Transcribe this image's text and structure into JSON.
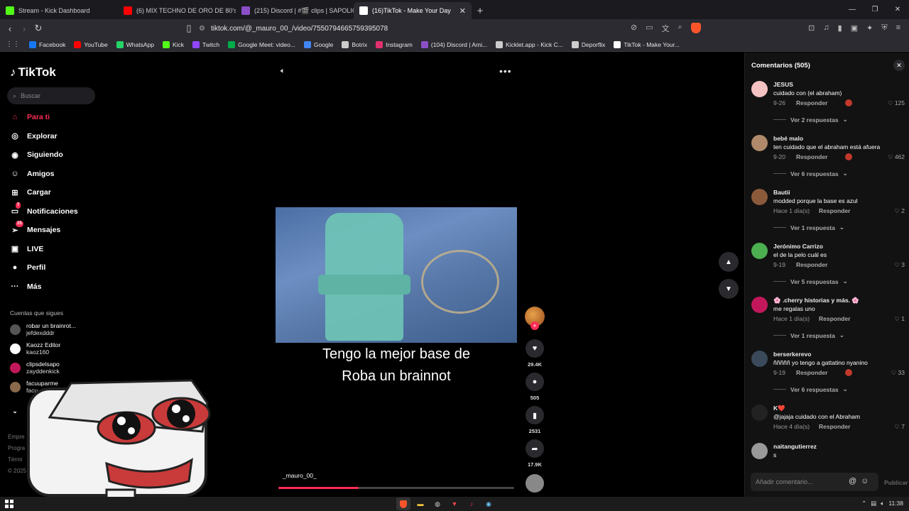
{
  "browser": {
    "tabs": [
      {
        "label": "Stream - Kick Dashboard",
        "color": "#53fc18",
        "active": false
      },
      {
        "label": "(6) MIX TECHNO DE ORO DE 80's &",
        "color": "#ff0000",
        "active": false
      },
      {
        "label": "(215) Discord | #🎬 clips | SAPOLIC",
        "color": "#8a4fc7",
        "active": false
      },
      {
        "label": "(16)TikTok - Make Your Day",
        "color": "#ffffff",
        "active": true
      }
    ],
    "url": "tiktok.com/@_mauro_00_/video/7550794665759395078",
    "bookmarks": [
      {
        "label": "Facebook",
        "color": "#1877f2"
      },
      {
        "label": "YouTube",
        "color": "#ff0000"
      },
      {
        "label": "WhatsApp",
        "color": "#25d366"
      },
      {
        "label": "Kick",
        "color": "#53fc18"
      },
      {
        "label": "Twitch",
        "color": "#9146ff"
      },
      {
        "label": "Google Meet: video...",
        "color": "#00ac47"
      },
      {
        "label": "Google",
        "color": "#4285f4"
      },
      {
        "label": "Botrix",
        "color": "#cccccc"
      },
      {
        "label": "Instagram",
        "color": "#e1306c"
      },
      {
        "label": "(104) Discord | Ami...",
        "color": "#8a4fc7"
      },
      {
        "label": "Kicklet.app - Kick C...",
        "color": "#cccccc"
      },
      {
        "label": "Deporflix",
        "color": "#cccccc"
      },
      {
        "label": "TikTok - Make Your...",
        "color": "#ffffff"
      }
    ]
  },
  "tiktok": {
    "logo": "TikTok",
    "search_placeholder": "Buscar",
    "nav": [
      {
        "label": "Para ti",
        "icon": "home-icon",
        "active": true,
        "badge": ""
      },
      {
        "label": "Explorar",
        "icon": "compass-icon",
        "active": false,
        "badge": ""
      },
      {
        "label": "Siguiendo",
        "icon": "following-icon",
        "active": false,
        "badge": ""
      },
      {
        "label": "Amigos",
        "icon": "friends-icon",
        "active": false,
        "badge": ""
      },
      {
        "label": "Cargar",
        "icon": "upload-icon",
        "active": false,
        "badge": ""
      },
      {
        "label": "Notificaciones",
        "icon": "inbox-icon",
        "active": false,
        "badge": "7"
      },
      {
        "label": "Mensajes",
        "icon": "messages-icon",
        "active": false,
        "badge": "15"
      },
      {
        "label": "LIVE",
        "icon": "live-icon",
        "active": false,
        "badge": ""
      },
      {
        "label": "Perfil",
        "icon": "profile-icon",
        "active": false,
        "badge": ""
      },
      {
        "label": "Más",
        "icon": "more-icon",
        "active": false,
        "badge": ""
      }
    ],
    "following_title": "Cuentas que sigues",
    "following": [
      {
        "name": "robar un brainrot...",
        "handle": "jefdexdddr"
      },
      {
        "name": "Kaozz Editor",
        "handle": "kaoz160"
      },
      {
        "name": "clipsdelsapo",
        "handle": "zayddenkick"
      },
      {
        "name": "facuuparme",
        "handle": "facu"
      }
    ],
    "see_more": "V",
    "footer": [
      "Empre",
      "Progra",
      "Térmi",
      "© 2025"
    ],
    "video": {
      "caption_line1": "Tengo la mejor base de",
      "caption_line2": "Roba un brainnot",
      "author": "_mauro_00_",
      "likes": "29.4K",
      "comments": "505",
      "saves": "2531",
      "shares": "17.9K",
      "progress": 0.34
    },
    "comments_header": "Comentarios (505)",
    "comments": [
      {
        "name": "JESUS",
        "text": "cuidado con (el abraham)",
        "date": "9-26",
        "reply": "Responder",
        "likes": "125",
        "more": "Ver 2 respuestas",
        "avatar": "#f4c2c2",
        "creator_liked": true
      },
      {
        "name": "bebé malo",
        "text": "ten cuidado que el abraham está afuera",
        "date": "9-20",
        "reply": "Responder",
        "likes": "462",
        "more": "Ver 6 respuestas",
        "avatar": "#b08a6a",
        "creator_liked": true
      },
      {
        "name": "Bautii",
        "text": "modded porque la base es azul",
        "date": "Hace 1 día(s)",
        "reply": "Responder",
        "likes": "2",
        "more": "Ver 1 respuesta",
        "avatar": "#8a5a3a",
        "creator_liked": false
      },
      {
        "name": "Jerónimo Carrizo",
        "text": "el de la pelo cuál es",
        "date": "9-19",
        "reply": "Responder",
        "likes": "3",
        "more": "Ver 5 respuestas",
        "avatar": "#4caf50",
        "creator_liked": false
      },
      {
        "name": "🌸 .cherry historias y más. 🌸",
        "text": "me regalas uno",
        "date": "Hace 1 día(s)",
        "reply": "Responder",
        "likes": "1",
        "more": "Ver 1 respuesta",
        "avatar": "#c2185b",
        "creator_liked": false
      },
      {
        "name": "berserkerevo",
        "text": "ñññññ yo tengo a gattatino nyanino",
        "date": "9-19",
        "reply": "Responder",
        "likes": "33",
        "more": "Ver 6 respuestas",
        "avatar": "#3a4a5a",
        "creator_liked": true
      },
      {
        "name": "K❤️",
        "text": "@jajaja cuidado con el Abraham",
        "date": "Hace 4 día(s)",
        "reply": "Responder",
        "likes": "7",
        "more": "",
        "avatar": "#222222",
        "creator_liked": false
      },
      {
        "name": "naitangutierrez",
        "text": "s",
        "date": "",
        "reply": "",
        "likes": "",
        "more": "",
        "avatar": "#999999",
        "creator_liked": false
      }
    ],
    "comment_placeholder": "Añadir comentario...",
    "publish": "Publicar"
  },
  "taskbar": {
    "time": "11:38"
  }
}
